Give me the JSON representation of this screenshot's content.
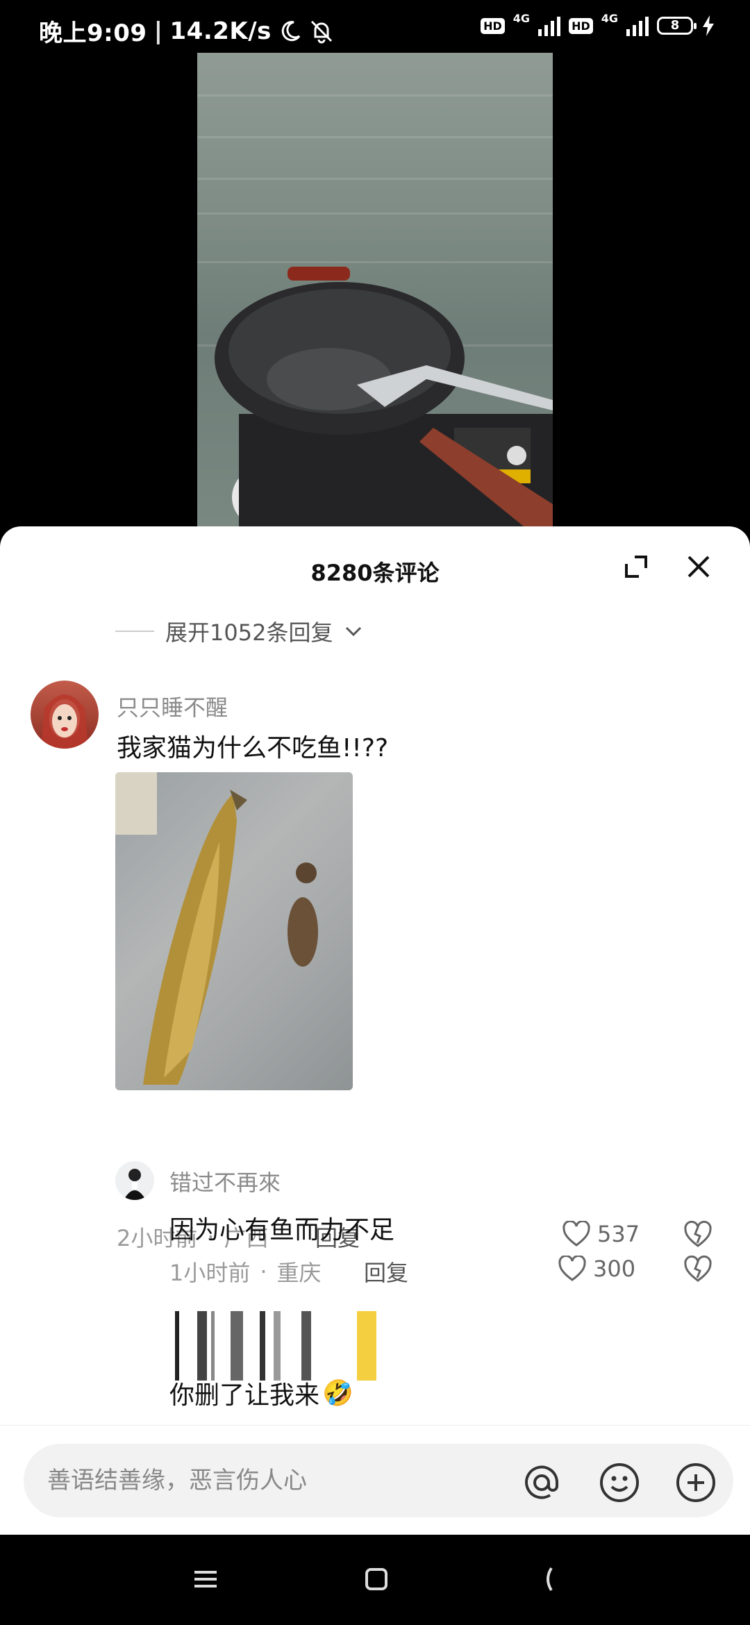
{
  "status_bar": {
    "time": "晚上9:09",
    "speed": "14.2K/s",
    "hd1": "HD",
    "net1": "4G",
    "hd2": "HD",
    "net2": "4G",
    "battery": "8",
    "icons": [
      "moon-icon",
      "mute-bell-icon",
      "signal-icon",
      "charging-icon"
    ]
  },
  "video": {
    "subject": "wok-on-boat-video"
  },
  "comments_sheet": {
    "title": "8280条评论",
    "expand_replies": "展开1052条回复",
    "comments": [
      {
        "user": "只只睡不醒",
        "text": "我家猫为什么不吃鱼!!??",
        "time": "2小时前",
        "location": "广西",
        "reply_label": "回复",
        "likes": "537"
      }
    ],
    "replies": [
      {
        "user": "错过不再來",
        "text": "因为心有鱼而力不足",
        "time": "1小时前",
        "location": "重庆",
        "reply_label": "回复",
        "likes": "300"
      }
    ],
    "partial_reply_text": "你删了让我来",
    "emoji": "🤣"
  },
  "input_bar": {
    "placeholder": "善语结善缘，恶言伤人心",
    "icons": [
      "at-icon",
      "emoji-icon",
      "add-icon"
    ]
  },
  "nav_bar": {
    "icons": [
      "menu-icon",
      "home-icon",
      "back-icon"
    ]
  },
  "colors": {
    "sheet_bg": "#ffffff",
    "accent_text": "#111111",
    "muted_text": "#8a8a8a"
  }
}
